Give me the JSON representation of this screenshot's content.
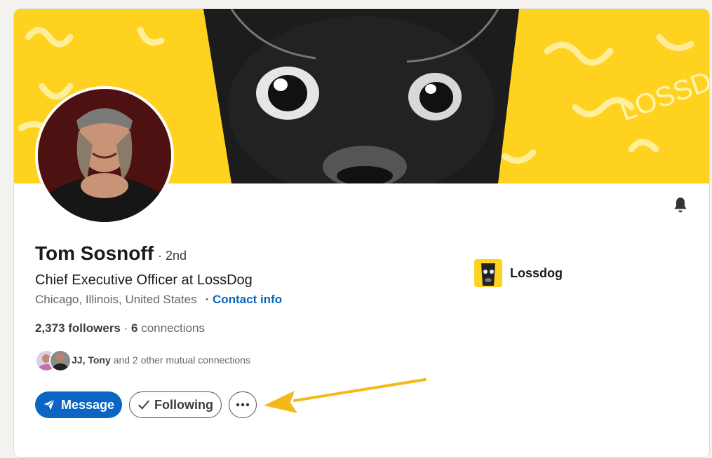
{
  "profile": {
    "name": "Tom Sosnoff",
    "degree": "· 2nd",
    "headline": "Chief Executive Officer at LossDog",
    "location": "Chicago, Illinois, United States",
    "contact_info": "· Contact info",
    "followers": "2,373 followers",
    "separator": " · ",
    "connections_count": "6",
    "connections_label": " connections"
  },
  "mutual": {
    "names": "JJ, Tony",
    "rest": " and 2 other mutual connections"
  },
  "actions": {
    "message_label": "Message",
    "following_label": "Following",
    "more_label": "More actions"
  },
  "company": {
    "name": "Lossdog"
  },
  "banner": {
    "text": "LOSSDOG"
  },
  "icons": {
    "bell": "bell-icon",
    "send": "paper-plane-icon",
    "check": "checkmark-icon",
    "more": "ellipsis-icon",
    "arrow": "annotation-arrow"
  },
  "colors": {
    "accent": "#0a66c2",
    "banner_yellow": "#ffd21f",
    "annotation_arrow": "#f5b81a"
  }
}
